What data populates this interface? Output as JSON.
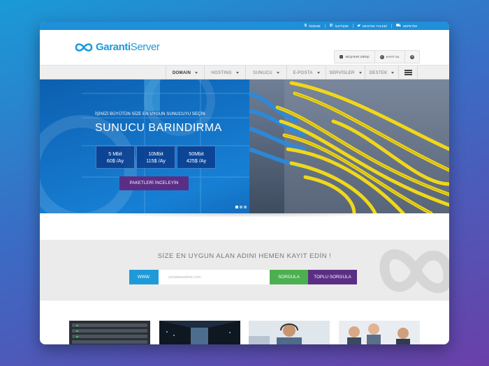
{
  "colors": {
    "accent": "#1e9ad8",
    "purple": "#5b2e86",
    "green": "#4caf50",
    "hero_blue": "#0f6fc0",
    "cable_yellow": "#f0d81a"
  },
  "topbar": {
    "links": [
      {
        "icon": "dollar-icon",
        "label": "ÖDEME"
      },
      {
        "icon": "phone-icon",
        "label": "İLETİŞİM"
      },
      {
        "icon": "ticket-icon",
        "label": "DESTEK TALEBİ"
      },
      {
        "icon": "cart-icon",
        "label": "SEPETİM"
      }
    ]
  },
  "header": {
    "brand_bold": "Garanti",
    "brand_rest": "Server",
    "buttons": [
      {
        "icon": "lock-icon",
        "label": "MÜŞTERİ GİRİŞİ"
      },
      {
        "icon": "plus-icon",
        "label": "KAYIT OL"
      },
      {
        "icon": "help-icon",
        "label": ""
      }
    ]
  },
  "nav": {
    "items": [
      "DOMAIN",
      "HOSTING",
      "SUNUCU",
      "E-POSTA",
      "SERVİSLER",
      "DESTEK"
    ],
    "menu_icon": "hamburger-menu-icon"
  },
  "hero": {
    "subtitle": "İŞİNİZİ BÜYÜTÜN SİZE EN UYGUN SUNUCUYU SEÇİN",
    "title": "SUNUCU BARINDIRMA",
    "plans": [
      {
        "speed": "5 Mbit",
        "price": "60$ /Ay"
      },
      {
        "speed": "10Mbit",
        "price": "115$ /Ay"
      },
      {
        "speed": "50Mbit",
        "price": "425$ /Ay"
      }
    ],
    "cta": "PAKETLERİ İNCELEYİN",
    "slide_count": 3,
    "active_slide": 1
  },
  "domain": {
    "heading": "SİZE EN UYGUN ALAN ADINI HEMEN KAYIT EDİN !",
    "prefix": "WWW.",
    "placeholder": "yenialanadiniz.com",
    "search_button": "SORGULA",
    "bulk_button": "TOPLU SORGULA"
  },
  "thumbnails": [
    "server-rack-photo",
    "datacenter-aisle-photo",
    "call-center-agent-photo",
    "business-team-photo"
  ]
}
